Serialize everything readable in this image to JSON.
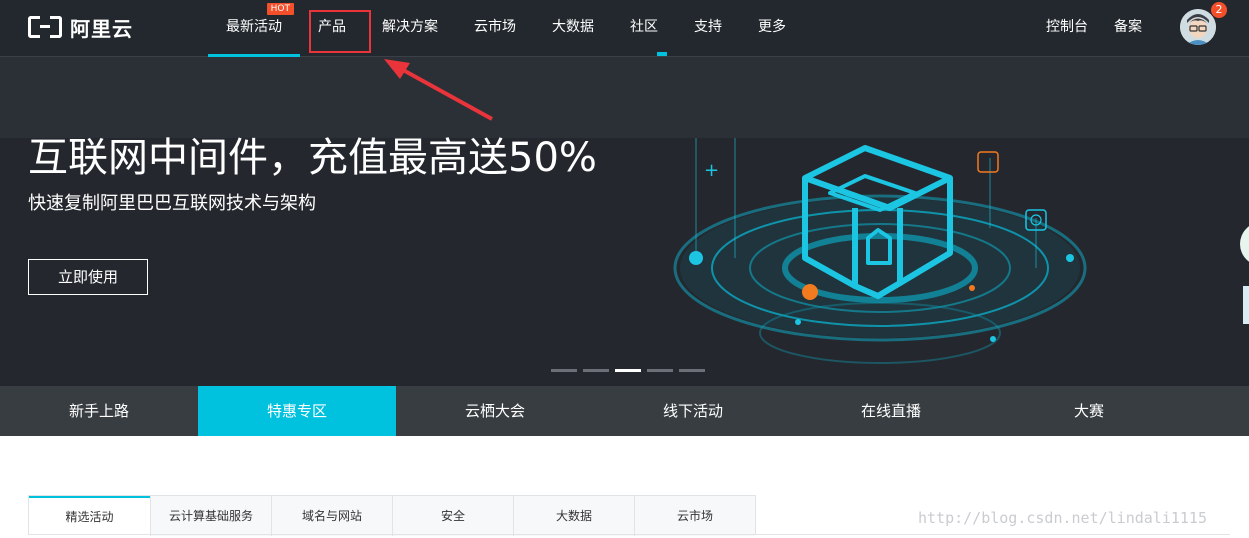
{
  "header": {
    "logo_text": "阿里云",
    "nav": [
      {
        "label": "最新活动",
        "badge": "HOT"
      },
      {
        "label": "产品"
      },
      {
        "label": "解决方案"
      },
      {
        "label": "云市场"
      },
      {
        "label": "大数据"
      },
      {
        "label": "社区"
      },
      {
        "label": "支持"
      },
      {
        "label": "更多"
      }
    ],
    "console": "控制台",
    "filing": "备案",
    "notification_count": "2"
  },
  "hero": {
    "title": "互联网中间件，充值最高送50%",
    "subtitle": "快速复制阿里巴巴互联网技术与架构",
    "cta": "立即使用",
    "slide_count": 5,
    "active_slide": 3
  },
  "categories": [
    "新手上路",
    "特惠专区",
    "云栖大会",
    "线下活动",
    "在线直播",
    "大赛"
  ],
  "active_category": "特惠专区",
  "tabs": [
    "精选活动",
    "云计算基础服务",
    "域名与网站",
    "安全",
    "大数据",
    "云市场"
  ],
  "watermark": "http://blog.csdn.net/lindali1115",
  "colors": {
    "accent": "#00c1de",
    "hot": "#f44f2b",
    "annotation": "#e8343a",
    "nav_bg": "#23282e"
  }
}
